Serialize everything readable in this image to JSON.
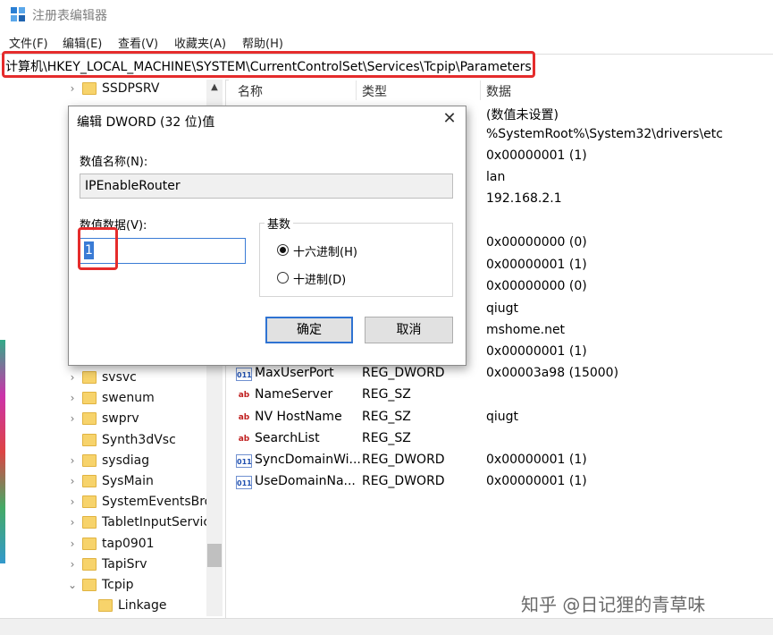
{
  "window": {
    "title": "注册表编辑器"
  },
  "menu": [
    "文件(F)",
    "编辑(E)",
    "查看(V)",
    "收藏夹(A)",
    "帮助(H)"
  ],
  "address": "计算机\\HKEY_LOCAL_MACHINE\\SYSTEM\\CurrentControlSet\\Services\\Tcpip\\Parameters",
  "tree": [
    {
      "label": "SSDPSRV",
      "arrow": "›"
    },
    {
      "label": "svsvc",
      "arrow": "›"
    },
    {
      "label": "swenum",
      "arrow": "›"
    },
    {
      "label": "swprv",
      "arrow": "›"
    },
    {
      "label": "Synth3dVsc",
      "arrow": ""
    },
    {
      "label": "sysdiag",
      "arrow": "›"
    },
    {
      "label": "SysMain",
      "arrow": "›"
    },
    {
      "label": "SystemEventsBrol",
      "arrow": "›"
    },
    {
      "label": "TabletInputServic",
      "arrow": "›"
    },
    {
      "label": "tap0901",
      "arrow": "›"
    },
    {
      "label": "TapiSrv",
      "arrow": "›"
    },
    {
      "label": "Tcpip",
      "arrow": "⌄"
    },
    {
      "label": "Linkage",
      "arrow": ""
    }
  ],
  "columns": {
    "name": "名称",
    "type": "类型",
    "data": "数据"
  },
  "data_column_values": [
    "(数值未设置)",
    "%SystemRoot%\\System32\\drivers\\etc",
    "0x00000001 (1)",
    "lan",
    "192.168.2.1",
    "0x00000000 (0)",
    "0x00000001 (1)",
    "0x00000000 (0)",
    "qiugt",
    "mshome.net",
    "0x00000001 (1)"
  ],
  "rows": [
    {
      "icon": "dword",
      "name": "MaxUserPort",
      "type": "REG_DWORD",
      "data": "0x00003a98 (15000)"
    },
    {
      "icon": "sz",
      "name": "NameServer",
      "type": "REG_SZ",
      "data": ""
    },
    {
      "icon": "sz",
      "name": "NV HostName",
      "type": "REG_SZ",
      "data": "qiugt"
    },
    {
      "icon": "sz",
      "name": "SearchList",
      "type": "REG_SZ",
      "data": ""
    },
    {
      "icon": "dword",
      "name": "SyncDomainWi...",
      "type": "REG_DWORD",
      "data": "0x00000001 (1)"
    },
    {
      "icon": "dword",
      "name": "UseDomainNa...",
      "type": "REG_DWORD",
      "data": "0x00000001 (1)"
    }
  ],
  "dialog": {
    "title": "编辑 DWORD (32 位)值",
    "name_label": "数值名称(N):",
    "name_value": "IPEnableRouter",
    "value_label": "数值数据(V):",
    "value": "1",
    "base_label": "基数",
    "hex_label": "十六进制(H)",
    "dec_label": "十进制(D)",
    "selected_base": "hex",
    "ok": "确定",
    "cancel": "取消"
  },
  "watermark": "知乎 @日记狸的青草味",
  "colors": {
    "highlight": "#e52c2c",
    "accent": "#3a7bd5",
    "folder": "#f7d36b"
  }
}
